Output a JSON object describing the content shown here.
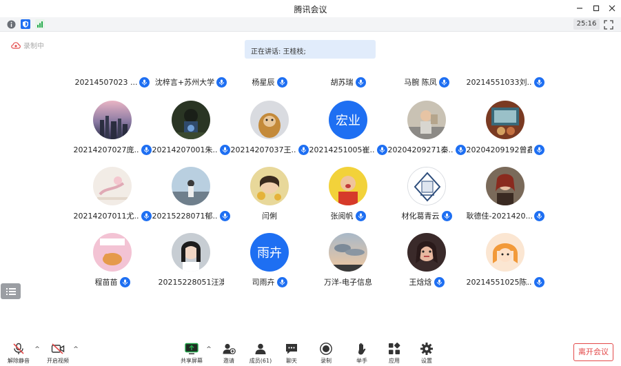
{
  "window": {
    "title": "腾讯会议"
  },
  "infobar": {
    "timer": "25:16"
  },
  "recording": {
    "label": "录制中"
  },
  "speaker": {
    "text": "正在讲话: 王桂枝;"
  },
  "participants_row0": [
    {
      "name": "20214507023 ..."
    },
    {
      "name": "沈梓言+苏州大学"
    },
    {
      "name": "杨星辰"
    },
    {
      "name": "胡苏瑞"
    },
    {
      "name": "马腕  陈凤"
    },
    {
      "name": "20214551033刘..."
    }
  ],
  "participants_row1": [
    {
      "name": "20214207027庞..."
    },
    {
      "name": "20214207001朱..."
    },
    {
      "name": "20214207037王..."
    },
    {
      "name": "20214251005崔...",
      "avatar_text": "宏业"
    },
    {
      "name": "20204209271秦..."
    },
    {
      "name": "20204209192曾鑫..."
    }
  ],
  "participants_row2": [
    {
      "name": "20214207011尤..."
    },
    {
      "name": "20215228071郁..."
    },
    {
      "name": "闫俐"
    },
    {
      "name": "张阅帆"
    },
    {
      "name": "材化葛青云"
    },
    {
      "name": "耿德佳-2021420..."
    }
  ],
  "participants_row3": [
    {
      "name": "程苗苗"
    },
    {
      "name": "20215228051汪澳"
    },
    {
      "name": "司雨卉",
      "avatar_text": "雨卉"
    },
    {
      "name": "万洋-电子信息"
    },
    {
      "name": "王焓焓"
    },
    {
      "name": "20214551025陈..."
    }
  ],
  "toolbar": {
    "unmute": "解除静音",
    "start_video": "开启视频",
    "share_screen": "共享屏幕",
    "invite": "邀请",
    "members": "成员(61)",
    "chat": "聊天",
    "record": "录制",
    "raise_hand": "举手",
    "apps": "应用",
    "settings": "设置",
    "leave": "离开会议"
  },
  "colors": {
    "accent_blue": "#1e6ff2",
    "leave_red": "#e34848",
    "banner_bg": "#e1ecfb",
    "share_green": "#22a94a"
  },
  "icons": [
    "info-icon",
    "shield-icon",
    "signal-icon",
    "fullscreen-icon",
    "cloud-recording-icon",
    "mic-icon",
    "list-icon",
    "mic-muted-icon",
    "camera-off-icon",
    "share-screen-icon",
    "add-user-icon",
    "members-icon",
    "chat-icon",
    "record-icon",
    "hand-icon",
    "apps-icon",
    "gear-icon"
  ]
}
